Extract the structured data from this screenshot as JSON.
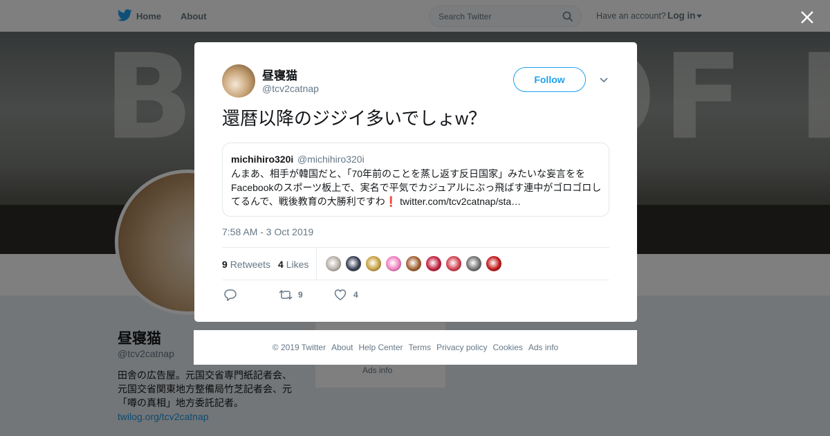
{
  "nav": {
    "home": "Home",
    "about": "About",
    "search_placeholder": "Search Twitter",
    "have_account": "Have an account?",
    "login": "Log in"
  },
  "banner": {
    "text": "BAND OF BROTHERS"
  },
  "profile": {
    "name": "昼寝猫",
    "handle": "@tcv2catnap",
    "bio_text": "田舎の広告屋。元国交省専門紙記者会、元国交省関東地方整備局竹芝記者会、元「噂の真相」地方委託記者。",
    "bio_link": "twilog.org/tcv2catnap",
    "side_card_text": "Ads info"
  },
  "tweet": {
    "name": "昼寝猫",
    "handle": "@tcv2catnap",
    "follow_label": "Follow",
    "text": "還暦以降のジジイ多いでしょw？",
    "quote": {
      "name": "michihiro320i",
      "handle": "@michihiro320i",
      "text": "んまあ、相手が韓国だと、「70年前のことを蒸し返す反日国家」みたいな妄言をを Facebookのスポーツ板上で、実名で平気でカジュアルにぶっ飛ばす連中がゴロゴロしてるんで、戦後教育の大勝利ですわ",
      "excl": "❗",
      "link": "twitter.com/tcv2catnap/sta…"
    },
    "time": "7:58 AM - 3 Oct 2019",
    "retweets_count": "9",
    "retweets_label": "Retweets",
    "likes_count": "4",
    "likes_label": "Likes",
    "likers": [
      "#b8b0a8",
      "#3a3f55",
      "#c8a040",
      "#f080c0",
      "#a06030",
      "#c02040",
      "#d04050",
      "#707070",
      "#c01818"
    ],
    "reply_count": "",
    "retweet_action_count": "9",
    "like_action_count": "4"
  },
  "footer": {
    "links": [
      "© 2019 Twitter",
      "About",
      "Help Center",
      "Terms",
      "Privacy policy",
      "Cookies",
      "Ads info"
    ]
  },
  "colors": {
    "accent": "#1da1f2",
    "text_secondary": "#657786"
  }
}
